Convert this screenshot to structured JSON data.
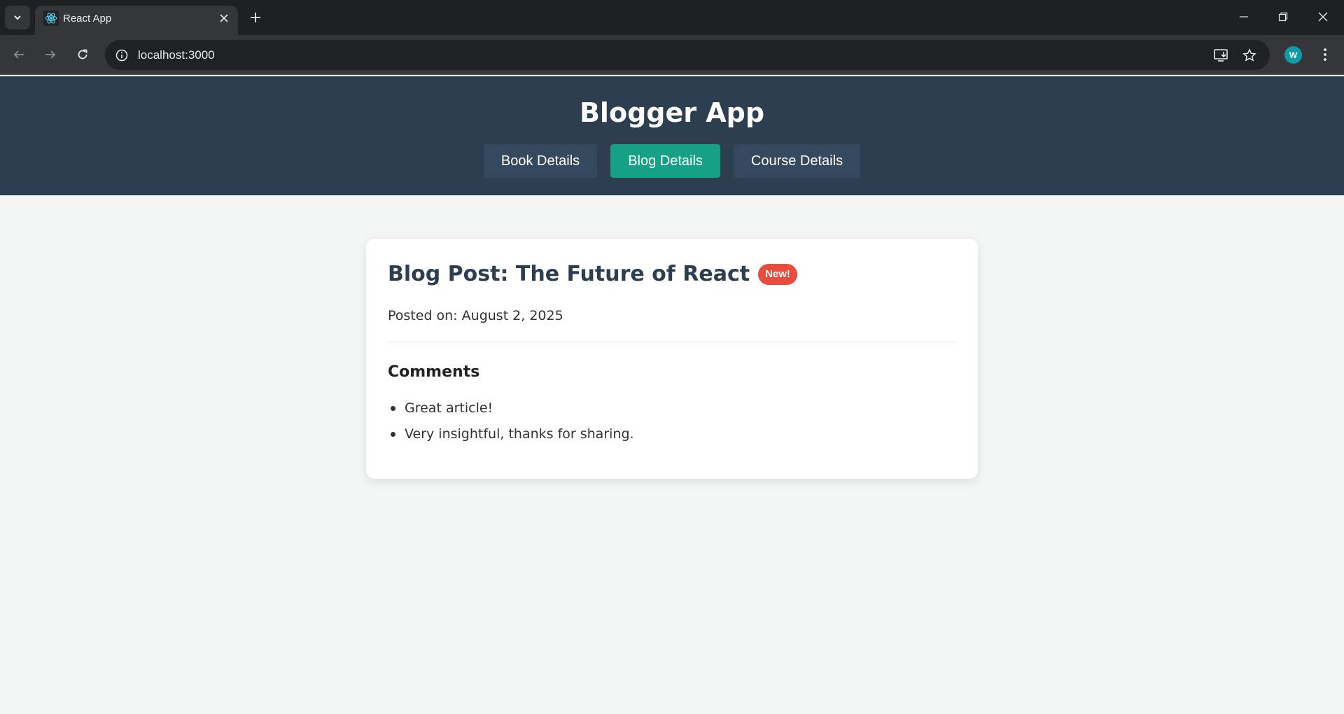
{
  "browser": {
    "tab_title": "React App",
    "url": "localhost:3000",
    "profile_initial": "W"
  },
  "app": {
    "title": "Blogger App",
    "nav": [
      {
        "label": "Book Details",
        "active": false
      },
      {
        "label": "Blog Details",
        "active": true
      },
      {
        "label": "Course Details",
        "active": false
      }
    ]
  },
  "post": {
    "title": "Blog Post: The Future of React",
    "badge": "New!",
    "posted": "Posted on: August 2, 2025",
    "comments_heading": "Comments",
    "comments": [
      "Great article!",
      "Very insightful, thanks for sharing."
    ]
  },
  "colors": {
    "header_bg": "#2c3e50",
    "nav_button_bg": "#34495e",
    "nav_active_bg": "#16a085",
    "badge_bg": "#e74c3c",
    "page_bg": "#f4f6f6"
  }
}
